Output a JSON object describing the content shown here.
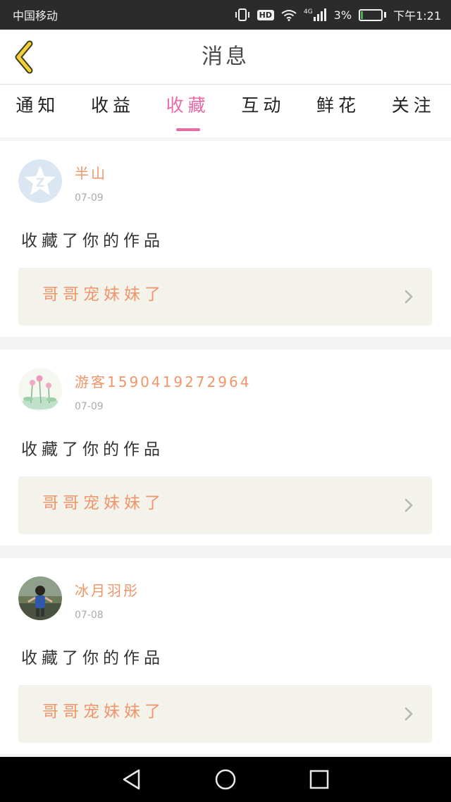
{
  "status_bar": {
    "carrier": "中国移动",
    "network": "4G",
    "battery": "3%",
    "battery_level": 0.03,
    "time": "下午1:21",
    "hd_label": "HD"
  },
  "header": {
    "title": "消息"
  },
  "tabs": [
    {
      "label": "通知",
      "active": false
    },
    {
      "label": "收益",
      "active": false
    },
    {
      "label": "收藏",
      "active": true
    },
    {
      "label": "互动",
      "active": false
    },
    {
      "label": "鲜花",
      "active": false
    },
    {
      "label": "关注",
      "active": false
    }
  ],
  "colors": {
    "accent_pink": "#e86aa6",
    "accent_orange": "#f0956a"
  },
  "notifications": [
    {
      "username": "半山",
      "date": "07-09",
      "action": "收藏了你的作品",
      "work_title": "哥哥宠妹妹了",
      "avatar": "qzone-star-icon"
    },
    {
      "username": "游客15904192729​64",
      "date": "07-09",
      "action": "收藏了你的作品",
      "work_title": "哥哥宠妹妹了",
      "avatar": "lotus-avatar"
    },
    {
      "username": "冰月羽彤",
      "date": "07-08",
      "action": "收藏了你的作品",
      "work_title": "哥哥宠妹妹了",
      "avatar": "person-photo-avatar"
    }
  ]
}
